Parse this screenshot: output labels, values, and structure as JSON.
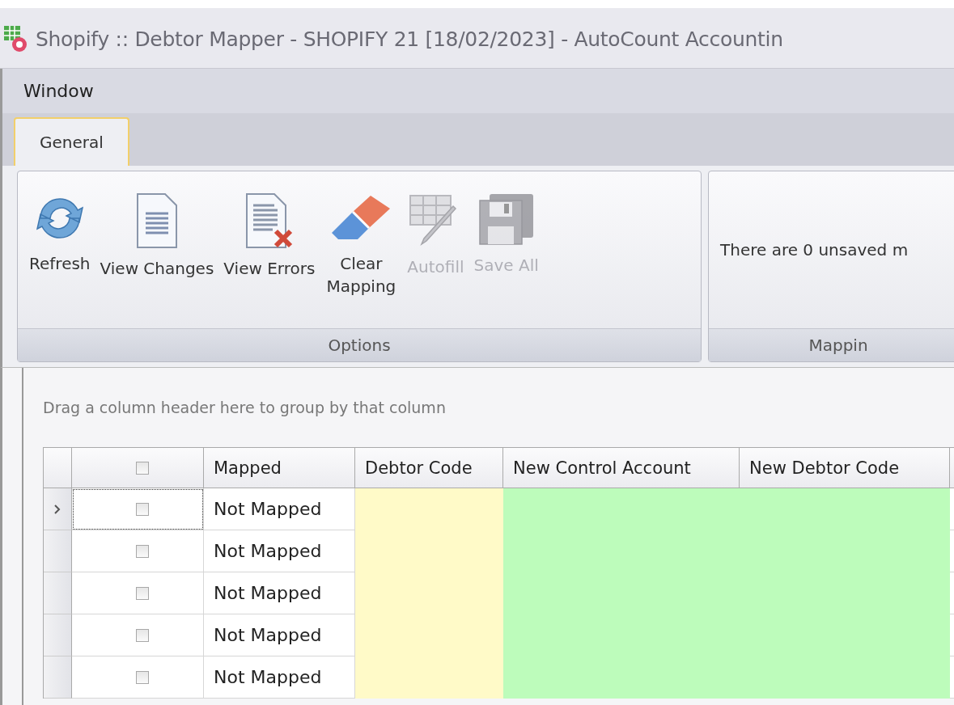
{
  "window": {
    "title": "Shopify :: Debtor Mapper - SHOPIFY 21 [18/02/2023] - AutoCount Accountin"
  },
  "menu": [
    {
      "label": "Window"
    }
  ],
  "tabs": [
    {
      "label": "General",
      "selected": true
    }
  ],
  "ribbon": {
    "groups": [
      {
        "label": "Options",
        "buttons": [
          {
            "kind": "refresh",
            "label": "Refresh",
            "disabled": false
          },
          {
            "kind": "document",
            "label": "View Changes",
            "disabled": false
          },
          {
            "kind": "document-error",
            "label": "View Errors",
            "disabled": false
          },
          {
            "kind": "eraser",
            "label": "Clear Mapping",
            "disabled": false
          },
          {
            "kind": "grid-edit",
            "label": "Autofill",
            "disabled": true
          },
          {
            "kind": "save",
            "label": "Save All",
            "disabled": true
          }
        ]
      },
      {
        "label": "Mappin",
        "message": "There are 0 unsaved m"
      }
    ]
  },
  "grid": {
    "group_hint": "Drag a column header here to group by that column",
    "columns": [
      {
        "kind": "check",
        "checked": false,
        "color": "#ffffff"
      },
      {
        "label": "Mapped",
        "color": "#ffffff"
      },
      {
        "label": "Debtor Code",
        "color": "#fffac8"
      },
      {
        "label": "New Control Account",
        "color": "#bdfcbb"
      },
      {
        "label": "New Debtor Code",
        "color": "#bdfcbb"
      }
    ],
    "rows": [
      {
        "current": true,
        "checked": false,
        "mapped": "Not Mapped"
      },
      {
        "current": false,
        "checked": false,
        "mapped": "Not Mapped"
      },
      {
        "current": false,
        "checked": false,
        "mapped": "Not Mapped"
      },
      {
        "current": false,
        "checked": false,
        "mapped": "Not Mapped"
      },
      {
        "current": false,
        "checked": false,
        "mapped": "Not Mapped"
      }
    ]
  }
}
